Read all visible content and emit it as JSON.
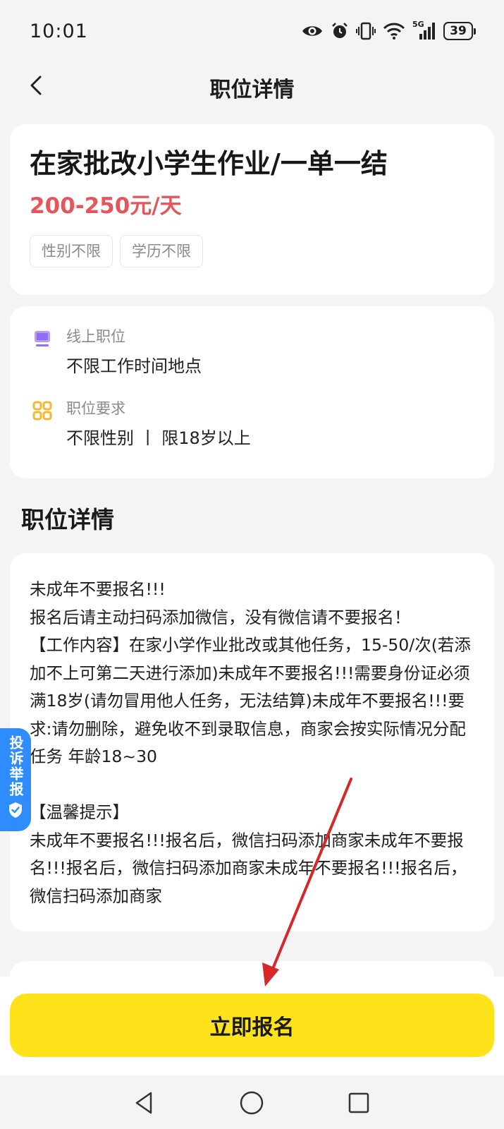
{
  "status_bar": {
    "time": "10:01",
    "battery": "39",
    "network": "5G",
    "icons": [
      "eye-icon",
      "alarm-icon",
      "vibrate-icon",
      "wifi-icon",
      "signal-icon",
      "battery-icon"
    ]
  },
  "nav": {
    "back_icon": "back-arrow-icon",
    "title": "职位详情"
  },
  "job": {
    "title": "在家批改小学生作业/一单一结",
    "salary": "200-250元/天",
    "tags": [
      "性别不限",
      "学历不限"
    ]
  },
  "info": [
    {
      "icon": "monitor-icon",
      "label": "线上职位",
      "value": "不限工作时间地点"
    },
    {
      "icon": "grid-icon",
      "label": "职位要求",
      "value": "不限性别 丨 限18岁以上"
    }
  ],
  "section_title": "职位详情",
  "detail": {
    "text": "未成年不要报名!!!\n报名后请主动扫码添加微信，没有微信请不要报名！\n【工作内容】在家小学作业批改或其他任务，15-50/次(若添加不上可第二天进行添加)未成年不要报名!!!需要身份证必须满18岁(请勿冒用他人任务，无法结算)未成年不要报名!!!要求:请勿删除，避免收不到录取信息，商家会按实际情况分配任务 年龄18~30\n\n【温馨提示】\n未成年不要报名!!!报名后，微信扫码添加商家未成年不要报名!!!报名后，微信扫码添加商家未成年不要报名!!!报名后，微信扫码添加商家"
  },
  "report": {
    "label": "投诉举报",
    "icon": "shield-check-icon"
  },
  "apply_button": "立即报名",
  "system_nav": [
    "back-triangle-icon",
    "home-circle-icon",
    "recents-square-icon"
  ],
  "colors": {
    "accent_yellow": "#ffe31a",
    "salary_red": "#e5555c",
    "report_blue": "#2f8cff",
    "page_bg": "#f3f4f6"
  }
}
